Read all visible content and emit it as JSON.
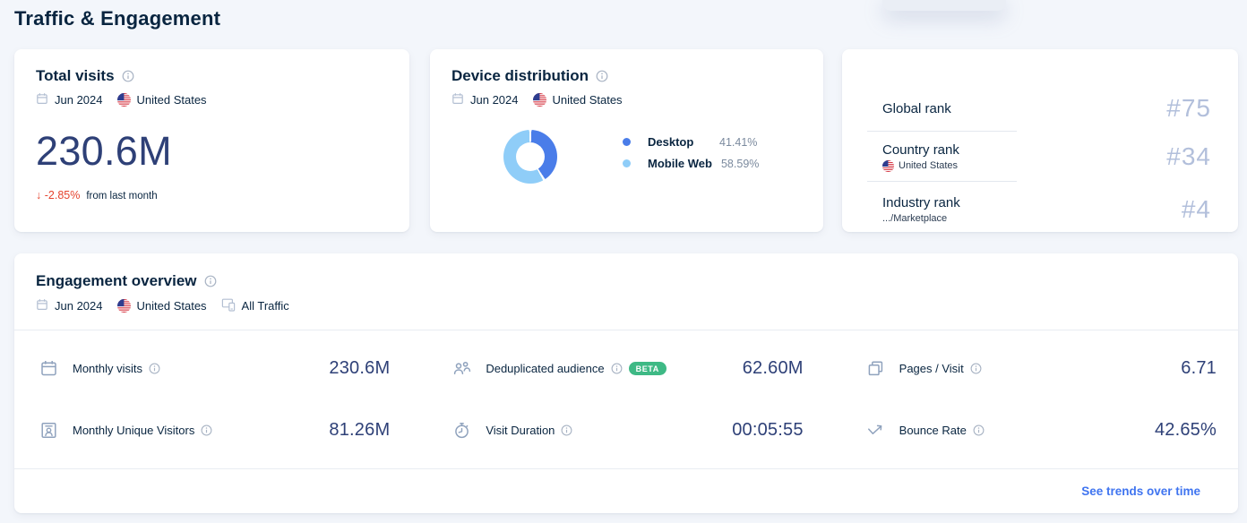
{
  "page": {
    "title": "Traffic & Engagement"
  },
  "cards": {
    "total_visits": {
      "title": "Total visits",
      "date": "Jun 2024",
      "country": "United States",
      "value": "230.6M",
      "change": "-2.85%",
      "change_note": "from last month"
    },
    "device_distribution": {
      "title": "Device distribution",
      "date": "Jun 2024",
      "country": "United States",
      "legend": [
        {
          "label": "Desktop",
          "value": "41.41%"
        },
        {
          "label": "Mobile Web",
          "value": "58.59%"
        }
      ]
    },
    "ranks": {
      "global": {
        "label": "Global rank",
        "value": "#75"
      },
      "country": {
        "label": "Country rank",
        "sub": "United States",
        "value": "#34"
      },
      "industry": {
        "label": "Industry rank",
        "sub": ".../Marketplace",
        "value": "#4"
      }
    }
  },
  "engagement": {
    "title": "Engagement overview",
    "date": "Jun 2024",
    "country": "United States",
    "traffic": "All Traffic",
    "metrics": [
      {
        "icon": "calendar-icon",
        "label": "Monthly visits",
        "value": "230.6M"
      },
      {
        "icon": "audience-icon",
        "label": "Deduplicated audience",
        "badge": "BETA",
        "value": "62.60M"
      },
      {
        "icon": "pages-icon",
        "label": "Pages / Visit",
        "value": "6.71"
      },
      {
        "icon": "unique-visitor-icon",
        "label": "Monthly Unique Visitors",
        "value": "81.26M"
      },
      {
        "icon": "stopwatch-icon",
        "label": "Visit Duration",
        "value": "00:05:55"
      },
      {
        "icon": "bounce-arrow-icon",
        "label": "Bounce Rate",
        "value": "42.65%"
      }
    ],
    "footer_link": "See trends over time"
  },
  "colors": {
    "desktop": "#4a7de9",
    "mobile_web": "#8fcdf8",
    "link_blue": "#3f74f0",
    "negative_red": "#e5432e",
    "beta_green": "#3eb985"
  },
  "chart_data": {
    "type": "pie",
    "title": "Device distribution",
    "labels": [
      "Desktop",
      "Mobile Web"
    ],
    "values": [
      41.41,
      58.59
    ],
    "colors": [
      "#4a7de9",
      "#8fcdf8"
    ],
    "hole": 0.55,
    "legend_position": "right"
  }
}
